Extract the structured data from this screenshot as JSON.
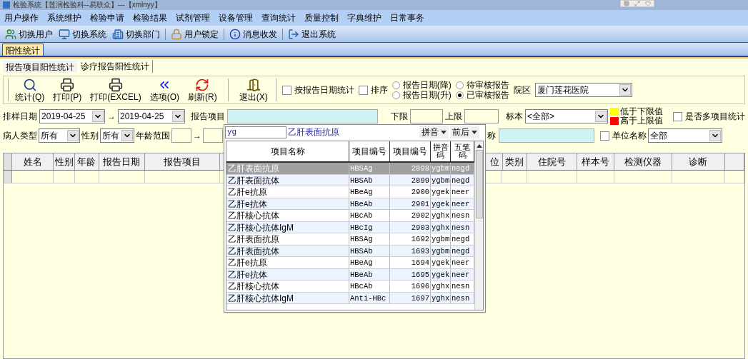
{
  "window": {
    "title": "检验系统【莲润检验科--易联众】---【xmlnyy】"
  },
  "menu": [
    "用户操作",
    "系统维护",
    "检验申请",
    "检验结果",
    "试剂管理",
    "设备管理",
    "查询统计",
    "质量控制",
    "字典维护",
    "日常事务"
  ],
  "toolbar": [
    {
      "kind": "users",
      "label": "切换用户"
    },
    {
      "kind": "system",
      "label": "切换系统"
    },
    {
      "kind": "dept",
      "label": "切换部门"
    },
    {
      "kind": "lock",
      "label": "用户锁定"
    },
    {
      "kind": "info",
      "label": "消息收发"
    },
    {
      "kind": "exit",
      "label": "退出系统"
    }
  ],
  "doc_tabs": [
    {
      "label": "阳性统计",
      "selected": true
    }
  ],
  "sub_tabs": [
    {
      "label": "报告项目阳性统计",
      "selected": true
    },
    {
      "label": "诊疗报告阳性统计",
      "selected": false
    }
  ],
  "actions": [
    {
      "kind": "search",
      "label": "统计(Q)"
    },
    {
      "kind": "print",
      "label": "打印(P)"
    },
    {
      "kind": "print",
      "label": "打印(EXCEL)"
    },
    {
      "kind": "options",
      "label": "选项(O)"
    },
    {
      "kind": "refresh",
      "label": "刷新(R)"
    },
    {
      "kind": "exit",
      "label": "退出(X)"
    }
  ],
  "options": {
    "by_date": {
      "label": "按报告日期统计",
      "checked": false
    },
    "sort": {
      "label": "排序",
      "checked": false
    },
    "sort_order": [
      {
        "label": "报告日期(降)",
        "selected": false
      },
      {
        "label": "报告日期(升)",
        "selected": false
      }
    ],
    "review": [
      {
        "label": "待审核报告",
        "selected": false
      },
      {
        "label": "已审核报告",
        "selected": true
      }
    ],
    "campus": {
      "label": "院区",
      "value": "厦门莲花医院"
    }
  },
  "filters": {
    "sample_date": {
      "label": "排样日期",
      "from": "2019-04-25",
      "arrow": "→",
      "to": "2019-04-25"
    },
    "report_item": {
      "label": "报告项目"
    },
    "lower": {
      "label": "下限"
    },
    "upper": {
      "label": "上限"
    },
    "specimen": {
      "label": "标本",
      "value": "<全部>"
    },
    "legend": [
      {
        "label": "低于下限值",
        "color": "#ffff00"
      },
      {
        "label": "高于上限值",
        "color": "#ff0000"
      }
    ],
    "multi": {
      "label": "是否多项目统计",
      "checked": false
    },
    "patient_type": {
      "label": "病人类型",
      "value": "所有"
    },
    "sex": {
      "label": "性别",
      "value": "所有"
    },
    "age": {
      "label": "年龄范围",
      "arrow": "→"
    },
    "name_label": "称",
    "unit": {
      "label": "单位名称",
      "checked": false,
      "value": "全部"
    }
  },
  "table": {
    "columns": [
      "姓名",
      "性别",
      "年龄",
      "报告日期",
      "报告项目",
      "",
      "位",
      "类别",
      "住院号",
      "样本号",
      "检测仪器",
      "诊断",
      ""
    ]
  },
  "popup": {
    "search_value": "yg",
    "current": "乙肝表面抗原",
    "menus": [
      "拼音",
      "前后"
    ],
    "columns": [
      "项目名称",
      "项目编号",
      "项目编号",
      "拼音码",
      "五笔码"
    ],
    "rows": [
      {
        "cells": [
          "乙肝表面抗原",
          "HBSAg",
          "2898",
          "ygbm",
          "negd"
        ],
        "selected": true
      },
      {
        "cells": [
          "乙肝表面抗体",
          "HBSAb",
          "2899",
          "ygbm",
          "negd"
        ],
        "selected": false
      },
      {
        "cells": [
          "乙肝e抗原",
          "HBeAg",
          "2900",
          "ygek",
          "neer"
        ],
        "selected": false
      },
      {
        "cells": [
          "乙肝e抗体",
          "HBeAb",
          "2901",
          "ygek",
          "neer"
        ],
        "selected": false
      },
      {
        "cells": [
          "乙肝核心抗体",
          "HBcAb",
          "2902",
          "yghx",
          "nesn"
        ],
        "selected": false
      },
      {
        "cells": [
          "乙肝核心抗体IgM",
          "HBcIg",
          "2903",
          "yghx",
          "nesn"
        ],
        "selected": false
      },
      {
        "cells": [
          "乙肝表面抗原",
          "HBSAg",
          "1692",
          "ygbm",
          "negd"
        ],
        "selected": false
      },
      {
        "cells": [
          "乙肝表面抗体",
          "HBSAb",
          "1693",
          "ygbm",
          "negd"
        ],
        "selected": false
      },
      {
        "cells": [
          "乙肝e抗原",
          "HBeAg",
          "1694",
          "ygek",
          "neer"
        ],
        "selected": false
      },
      {
        "cells": [
          "乙肝e抗体",
          "HBeAb",
          "1695",
          "ygek",
          "neer"
        ],
        "selected": false
      },
      {
        "cells": [
          "乙肝核心抗体",
          "HBcAb",
          "1696",
          "yghx",
          "nesn"
        ],
        "selected": false
      },
      {
        "cells": [
          "乙肝核心抗体IgM",
          "Anti-HBc",
          "1697",
          "yghx",
          "nesn"
        ],
        "selected": false
      }
    ]
  }
}
